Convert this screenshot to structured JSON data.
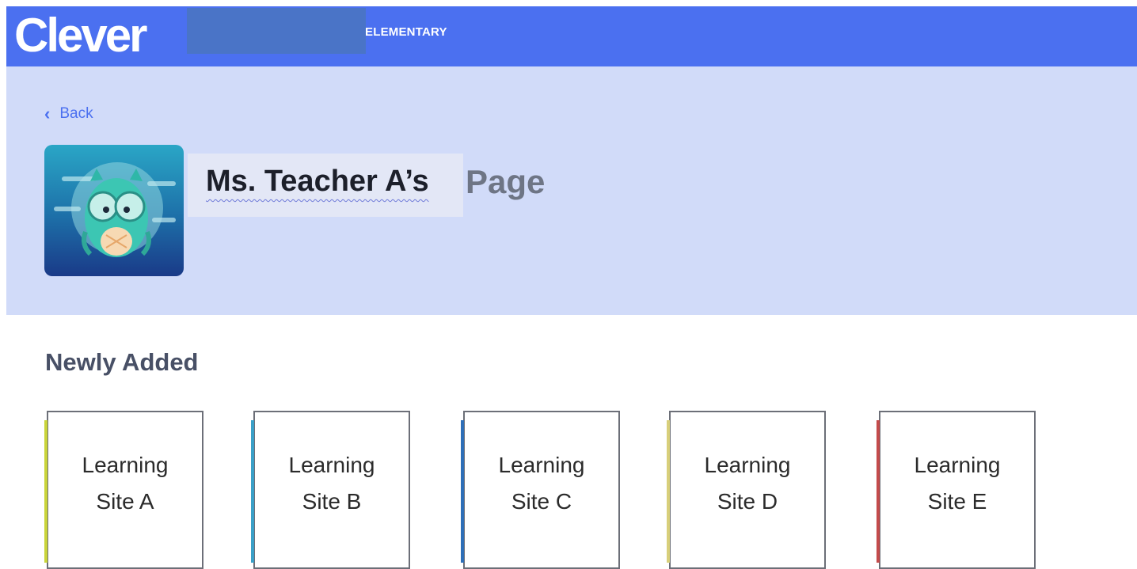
{
  "header": {
    "logo": "Clever",
    "school_name": "ELEMENTARY"
  },
  "hero": {
    "back_label": "Back",
    "teacher_name": "Ms. Teacher A’s",
    "page_word": "Page"
  },
  "section": {
    "title": "Newly Added"
  },
  "cards": [
    {
      "label": "Learning\nSite A",
      "accent": "#c9d43a"
    },
    {
      "label": "Learning\nSite B",
      "accent": "#3aa0c8"
    },
    {
      "label": "Learning\nSite C",
      "accent": "#2e6fb8"
    },
    {
      "label": "Learning\nSite D",
      "accent": "#d8cf7a"
    },
    {
      "label": "Learning\nSite E",
      "accent": "#c44b4b"
    }
  ],
  "colors": {
    "brand": "#4b70f0",
    "hero_bg": "#d1dbf9"
  }
}
